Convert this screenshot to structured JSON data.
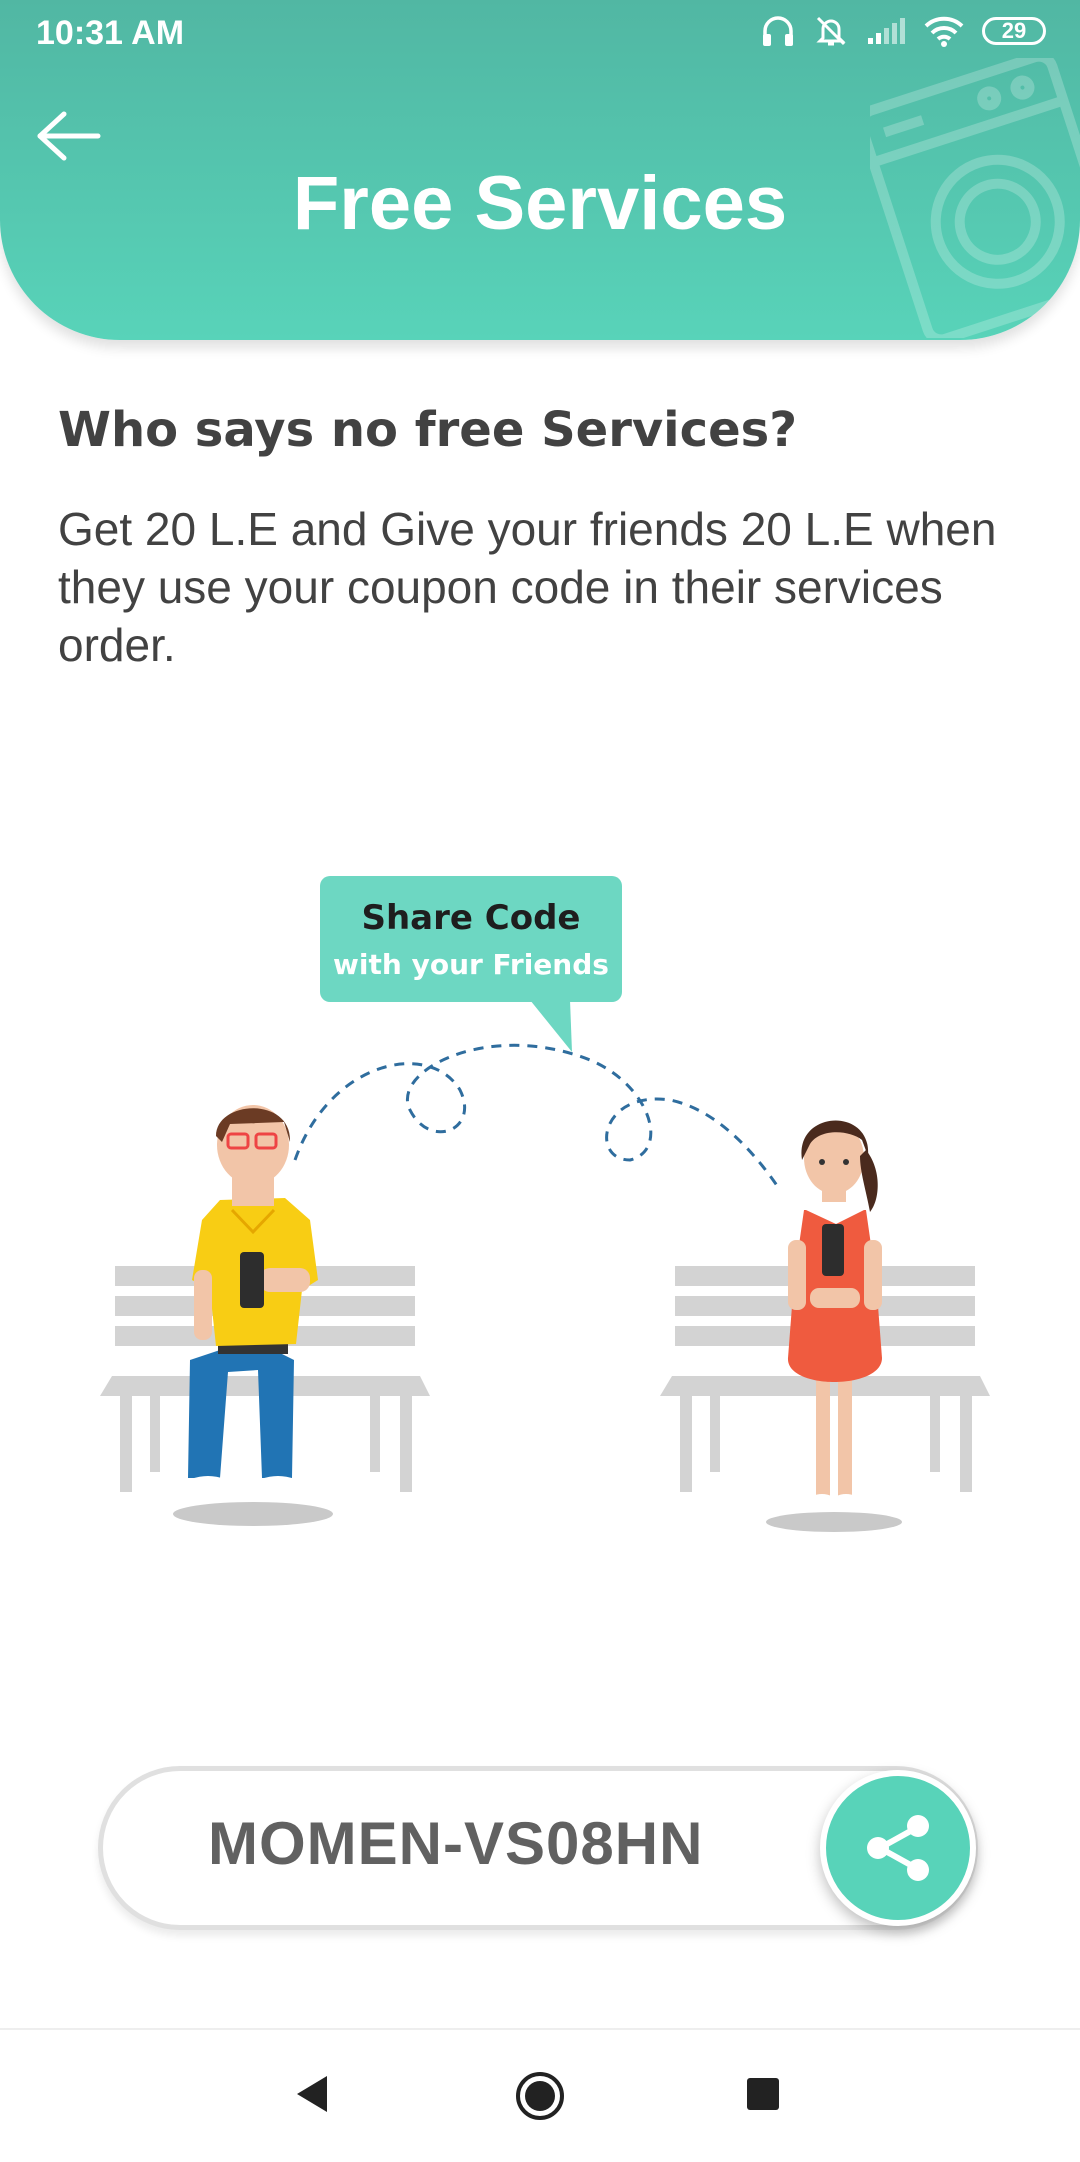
{
  "status_bar": {
    "time": "10:31 AM",
    "battery": "29",
    "icons": [
      "headphones-icon",
      "bell-off-icon",
      "signal-icon",
      "wifi-icon",
      "battery-icon"
    ]
  },
  "header": {
    "title": "Free Services",
    "back_icon": "arrow-left-icon",
    "decoration_icon": "washing-machine-icon",
    "color": "#58d3b9"
  },
  "content": {
    "heading": "Who says no free Services?",
    "description": "Get 20 L.E and Give your friends 20 L.E when they use your coupon code in their services order."
  },
  "illustration": {
    "bubble_line1": "Share Code",
    "bubble_line2": "with your Friends"
  },
  "coupon": {
    "code": "MOMEN-VS08HN",
    "share_icon": "share-icon"
  },
  "nav": {
    "back_icon": "nav-back-icon",
    "home_icon": "nav-home-icon",
    "recents_icon": "nav-recents-icon"
  }
}
